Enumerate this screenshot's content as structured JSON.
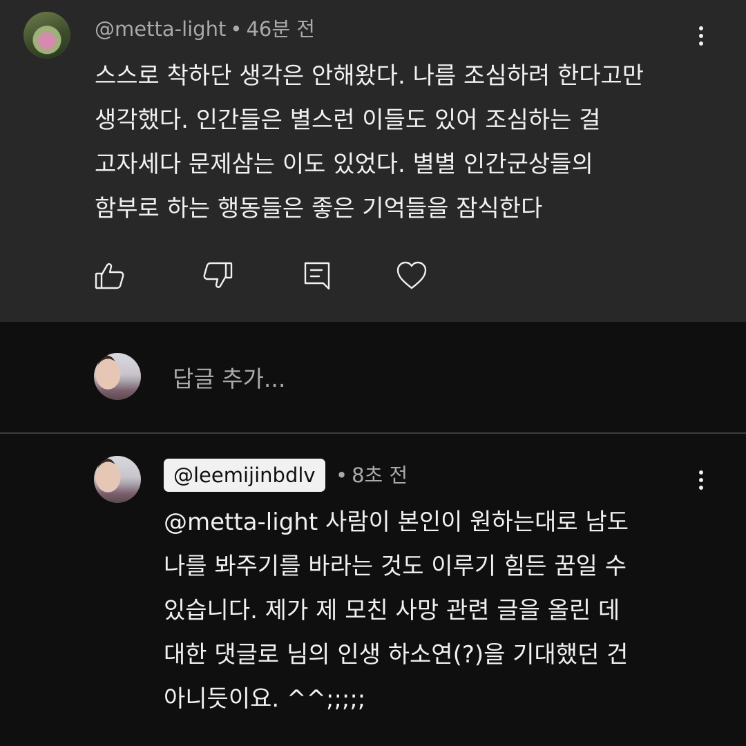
{
  "top_comment": {
    "author": "@metta-light",
    "separator": "•",
    "time": "46분 전",
    "lines": [
      "스스로 착하단 생각은 안해왔다. 나름 조심하려 한다고만",
      "생각했다. 인간들은 별스런 이들도 있어 조심하는 걸",
      "고자세다 문제삼는 이도 있었다. 별별 인간군상들의",
      "함부로 하는 행동들은 좋은 기억들을 잠식한다"
    ],
    "actions": [
      "like-icon",
      "dislike-icon",
      "reply-icon",
      "heart-icon"
    ]
  },
  "reply_input": {
    "placeholder": "답글 추가..."
  },
  "reply": {
    "author": "@leemijinbdlv",
    "separator": "•",
    "time": "8초 전",
    "lines": [
      "@metta-light  사람이 본인이 원하는대로 남도",
      "나를 봐주기를 바라는 것도 이루기 힘든 꿈일 수",
      "있습니다. 제가 제 모친 사망 관련 글을 올린 데",
      "대한 댓글로 님의 인생 하소연(?)을 기대했던 건",
      "아니듯이요. ^^;;;;;"
    ]
  },
  "colors": {
    "top_panel_bg": "#282828",
    "page_bg": "#0f0f0f",
    "text_primary": "#f1f1f1",
    "text_secondary": "#aaaaaa",
    "author_chip_bg": "#f1f1f1"
  }
}
